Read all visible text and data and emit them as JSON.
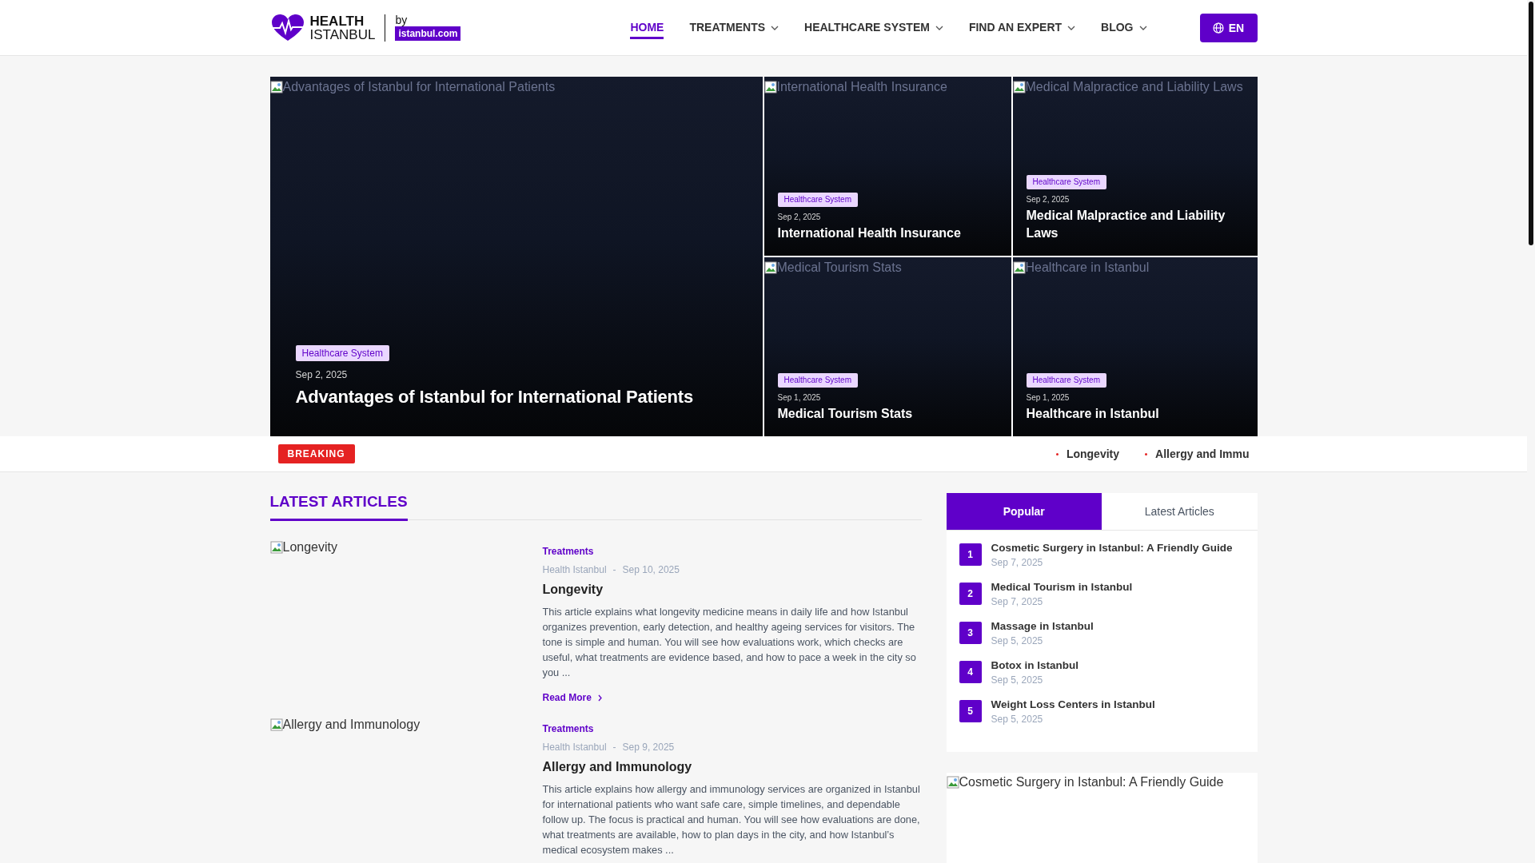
{
  "header": {
    "logo": {
      "word_top": "HEALTH",
      "word_bottom": "ISTANBUL",
      "by": "by",
      "brand": "istanbul.com"
    },
    "nav": [
      {
        "label": "HOME",
        "selected": true,
        "dropdown": false
      },
      {
        "label": "TREATMENTS",
        "selected": false,
        "dropdown": true
      },
      {
        "label": "HEALTHCARE SYSTEM",
        "selected": false,
        "dropdown": true
      },
      {
        "label": "FIND AN EXPERT",
        "selected": false,
        "dropdown": true
      },
      {
        "label": "BLOG",
        "selected": false,
        "dropdown": true
      }
    ],
    "language": "EN"
  },
  "hero": [
    {
      "kind": "large",
      "image_alt": "Advantages of Istanbul for International Patients",
      "category": "Healthcare System",
      "date": "Sep 2, 2025",
      "title": "Advantages of Istanbul for International Patients"
    },
    {
      "kind": "small",
      "image_alt": "International Health Insurance",
      "category": "Healthcare System",
      "date": "Sep 2, 2025",
      "title": "International Health Insurance"
    },
    {
      "kind": "small",
      "image_alt": "Medical Malpractice and Liability Laws",
      "category": "Healthcare System",
      "date": "Sep 2, 2025",
      "title": "Medical Malpractice and Liability Laws"
    },
    {
      "kind": "small",
      "image_alt": "Medical Tourism Stats",
      "category": "Healthcare System",
      "date": "Sep 1, 2025",
      "title": "Medical Tourism Stats"
    },
    {
      "kind": "small",
      "image_alt": "Healthcare in Istanbul",
      "category": "Healthcare System",
      "date": "Sep 1, 2025",
      "title": "Healthcare in Istanbul"
    }
  ],
  "breaking": {
    "label": "BREAKING",
    "items": [
      "Longevity",
      "Allergy and Immu"
    ]
  },
  "latest": {
    "heading": "LATEST ARTICLES",
    "articles": [
      {
        "image_alt": "Longevity",
        "category": "Treatments",
        "author": "Health Istanbul",
        "separator": "-",
        "date": "Sep 10, 2025",
        "title": "Longevity",
        "excerpt": "This article explains what longevity medicine means in daily life and how Istanbul organizes prevention, early detection, and healthy ageing services for visitors. The tone is simple and human. You will see how evaluations work, which checks are useful, what treatments are evidence based, and how to pace a week in the city so you ...",
        "read_more": "Read More"
      },
      {
        "image_alt": "Allergy and Immunology",
        "category": "Treatments",
        "author": "Health Istanbul",
        "separator": "-",
        "date": "Sep 9, 2025",
        "title": "Allergy and Immunology",
        "excerpt": "This article explains how allergy and immunology services are organized in Istanbul for international patients who want safe care, simple timelines, and dependable follow up. The focus is practical and human. You will see how evaluations are done, what treatments are available, how to plan days in the city, and how Istanbul’s medical ecosystem makes ..."
      }
    ]
  },
  "sidebar": {
    "tabs": [
      {
        "label": "Popular",
        "selected": true
      },
      {
        "label": "Latest Articles",
        "selected": false
      }
    ],
    "items": [
      {
        "rank": "1",
        "title": "Cosmetic Surgery in Istanbul: A Friendly Guide",
        "date": "Sep 7, 2025"
      },
      {
        "rank": "2",
        "title": "Medical Tourism in Istanbul",
        "date": "Sep 7, 2025"
      },
      {
        "rank": "3",
        "title": "Massage in Istanbul",
        "date": "Sep 5, 2025"
      },
      {
        "rank": "4",
        "title": "Botox in Istanbul",
        "date": "Sep 5, 2025"
      },
      {
        "rank": "5",
        "title": "Weight Loss Centers in Istanbul",
        "date": "Sep 5, 2025"
      }
    ],
    "featured": {
      "image_alt": "Cosmetic Surgery in Istanbul: A Friendly Guide"
    }
  }
}
